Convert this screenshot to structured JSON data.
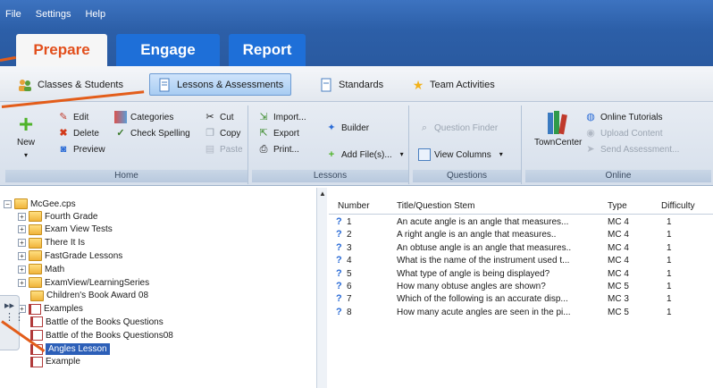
{
  "menu": [
    "File",
    "Settings",
    "Help"
  ],
  "main_tabs": [
    "Prepare",
    "Engage",
    "Report"
  ],
  "sub_tabs": [
    "Classes & Students",
    "Lessons & Assessments",
    "Standards",
    "Team Activities"
  ],
  "ribbon": {
    "home": {
      "label": "Home",
      "new": "New",
      "edit": "Edit",
      "delete": "Delete",
      "preview": "Preview",
      "categories": "Categories",
      "check_spelling": "Check Spelling",
      "cut": "Cut",
      "copy": "Copy",
      "paste": "Paste"
    },
    "lessons": {
      "label": "Lessons",
      "import": "Import...",
      "export": "Export",
      "print": "Print...",
      "builder": "Builder",
      "add_files": "Add File(s)..."
    },
    "questions": {
      "label": "Questions",
      "question_finder": "Question Finder",
      "view_columns": "View Columns"
    },
    "online": {
      "label": "Online",
      "towncenter": "TownCenter",
      "online_tutorials": "Online Tutorials",
      "upload_content": "Upload Content",
      "send_assessment": "Send Assessment..."
    }
  },
  "tree": {
    "root": "McGee.cps",
    "items": [
      {
        "label": "Fourth Grade",
        "kind": "folder",
        "exp": "+"
      },
      {
        "label": "Exam View Tests",
        "kind": "folder",
        "exp": "+"
      },
      {
        "label": "There It Is",
        "kind": "folder",
        "exp": "+"
      },
      {
        "label": "FastGrade Lessons",
        "kind": "folder",
        "exp": "+"
      },
      {
        "label": "Math",
        "kind": "folder",
        "exp": "+"
      },
      {
        "label": "ExamView/LearningSeries",
        "kind": "folder",
        "exp": "+"
      },
      {
        "label": "Children's Book Award 08",
        "kind": "folder",
        "exp": ""
      },
      {
        "label": "Examples",
        "kind": "book",
        "exp": "+"
      },
      {
        "label": "Battle of the Books Questions",
        "kind": "book",
        "exp": ""
      },
      {
        "label": "Battle of the Books Questions08",
        "kind": "book",
        "exp": ""
      },
      {
        "label": "Angles Lesson",
        "kind": "book",
        "exp": "",
        "selected": true
      },
      {
        "label": "Example",
        "kind": "book",
        "exp": ""
      }
    ]
  },
  "table": {
    "headers": [
      "Number",
      "Title/Question Stem",
      "Type",
      "Difficulty"
    ],
    "rows": [
      {
        "num": "1",
        "stem": "An acute angle is an angle that measures...",
        "type": "MC 4",
        "diff": "1"
      },
      {
        "num": "2",
        "stem": "A right angle is an angle that measures..",
        "type": "MC 4",
        "diff": "1"
      },
      {
        "num": "3",
        "stem": "An obtuse angle is an angle that measures..",
        "type": "MC 4",
        "diff": "1"
      },
      {
        "num": "4",
        "stem": "What is the name of the instrument used t...",
        "type": "MC 4",
        "diff": "1"
      },
      {
        "num": "5",
        "stem": "What type of angle is being displayed?",
        "type": "MC 4",
        "diff": "1"
      },
      {
        "num": "6",
        "stem": "How many obtuse angles are shown?",
        "type": "MC 5",
        "diff": "1"
      },
      {
        "num": "7",
        "stem": "Which of the following is an accurate disp...",
        "type": "MC 3",
        "diff": "1"
      },
      {
        "num": "8",
        "stem": "How many acute angles are seen in the pi...",
        "type": "MC 5",
        "diff": "1"
      }
    ]
  },
  "colors": {
    "accent": "#e24f1c",
    "header": "#2c5fa8",
    "tab_blue": "#1e6fd8",
    "selection": "#2c5fb8"
  }
}
